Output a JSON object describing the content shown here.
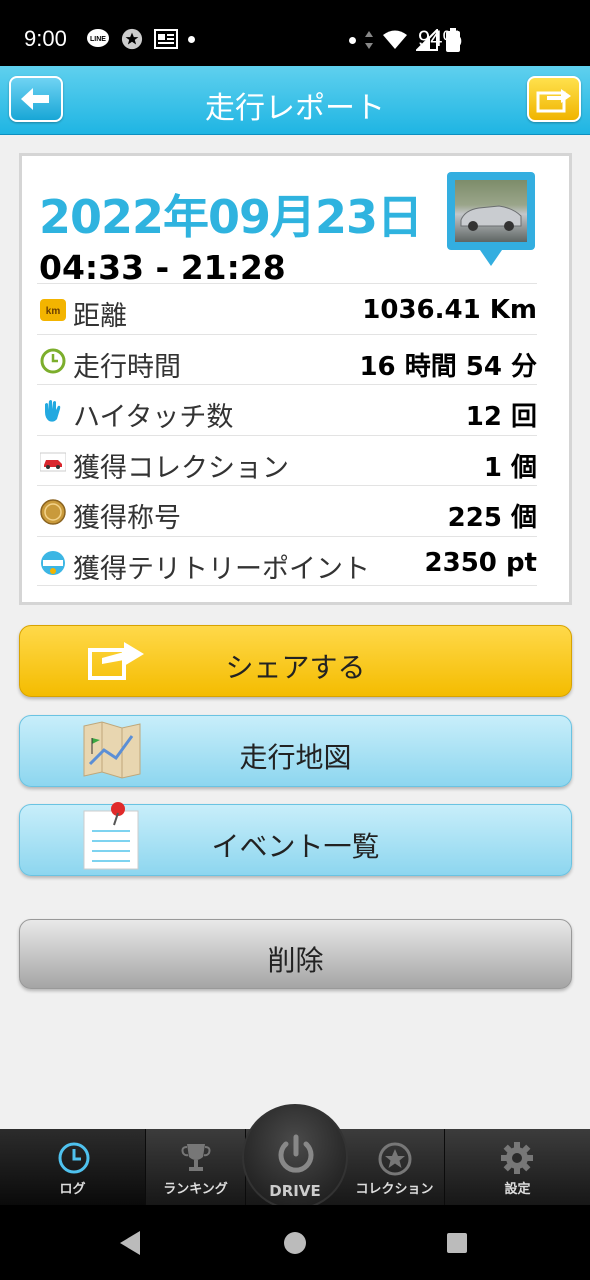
{
  "status_bar": {
    "time": "9:00",
    "battery": "94%",
    "icons": [
      "line-icon",
      "star-notification-icon",
      "news-icon",
      "dot",
      "dot",
      "data-arrows-icon",
      "wifi-icon",
      "signal-icon",
      "battery-icon"
    ]
  },
  "header": {
    "title": "走行レポート",
    "back_icon": "back-arrow-icon",
    "share_icon": "share-arrow-icon"
  },
  "report": {
    "date": "2022年09月23日",
    "time_range": "04:33 - 21:28",
    "stats": [
      {
        "icon": "km-icon",
        "label": "距離",
        "value": "1036.41 Km"
      },
      {
        "icon": "clock-icon",
        "label": "走行時間",
        "value": "16 時間 54 分"
      },
      {
        "icon": "hi-touch-hand-icon",
        "label": "ハイタッチ数",
        "value": "12 回"
      },
      {
        "icon": "car-card-icon",
        "label": "獲得コレクション",
        "value": "1 個"
      },
      {
        "icon": "title-medal-icon",
        "label": "獲得称号",
        "value": "225 個"
      },
      {
        "icon": "spot-badge-icon",
        "label": "獲得テリトリーポイント",
        "value": "2350 pt"
      }
    ]
  },
  "actions": {
    "share": "シェアする",
    "map": "走行地図",
    "events": "イベント一覧",
    "delete": "削除"
  },
  "tabs": {
    "log": "ログ",
    "ranking": "ランキング",
    "drive": "DRIVE",
    "collection": "コレクション",
    "settings": "設定"
  },
  "colors": {
    "header": "#1fb5e3",
    "date": "#2fb3df",
    "share_button": "#f4bc00",
    "light_button": "#8dd6ef",
    "delete_button": "#a5a5a5",
    "tab_bar": "#171717"
  }
}
